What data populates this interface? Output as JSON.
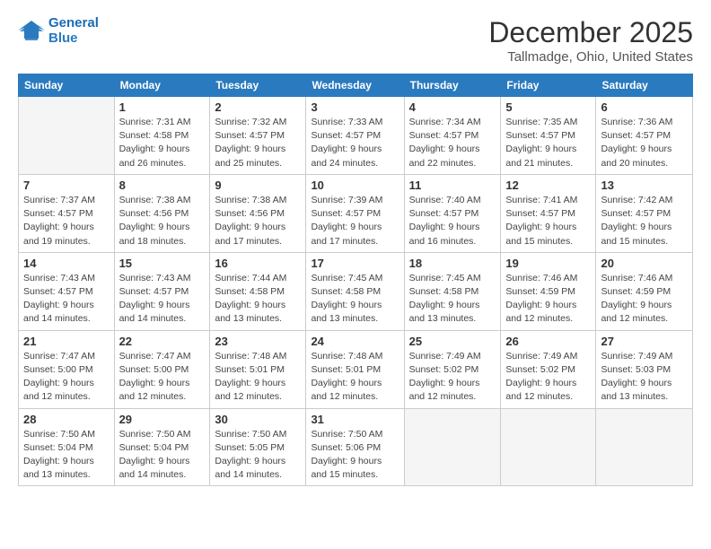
{
  "logo": {
    "line1": "General",
    "line2": "Blue"
  },
  "title": "December 2025",
  "location": "Tallmadge, Ohio, United States",
  "days_of_week": [
    "Sunday",
    "Monday",
    "Tuesday",
    "Wednesday",
    "Thursday",
    "Friday",
    "Saturday"
  ],
  "weeks": [
    [
      {
        "day": "",
        "info": ""
      },
      {
        "day": "1",
        "info": "Sunrise: 7:31 AM\nSunset: 4:58 PM\nDaylight: 9 hours\nand 26 minutes."
      },
      {
        "day": "2",
        "info": "Sunrise: 7:32 AM\nSunset: 4:57 PM\nDaylight: 9 hours\nand 25 minutes."
      },
      {
        "day": "3",
        "info": "Sunrise: 7:33 AM\nSunset: 4:57 PM\nDaylight: 9 hours\nand 24 minutes."
      },
      {
        "day": "4",
        "info": "Sunrise: 7:34 AM\nSunset: 4:57 PM\nDaylight: 9 hours\nand 22 minutes."
      },
      {
        "day": "5",
        "info": "Sunrise: 7:35 AM\nSunset: 4:57 PM\nDaylight: 9 hours\nand 21 minutes."
      },
      {
        "day": "6",
        "info": "Sunrise: 7:36 AM\nSunset: 4:57 PM\nDaylight: 9 hours\nand 20 minutes."
      }
    ],
    [
      {
        "day": "7",
        "info": "Sunrise: 7:37 AM\nSunset: 4:57 PM\nDaylight: 9 hours\nand 19 minutes."
      },
      {
        "day": "8",
        "info": "Sunrise: 7:38 AM\nSunset: 4:56 PM\nDaylight: 9 hours\nand 18 minutes."
      },
      {
        "day": "9",
        "info": "Sunrise: 7:38 AM\nSunset: 4:56 PM\nDaylight: 9 hours\nand 17 minutes."
      },
      {
        "day": "10",
        "info": "Sunrise: 7:39 AM\nSunset: 4:57 PM\nDaylight: 9 hours\nand 17 minutes."
      },
      {
        "day": "11",
        "info": "Sunrise: 7:40 AM\nSunset: 4:57 PM\nDaylight: 9 hours\nand 16 minutes."
      },
      {
        "day": "12",
        "info": "Sunrise: 7:41 AM\nSunset: 4:57 PM\nDaylight: 9 hours\nand 15 minutes."
      },
      {
        "day": "13",
        "info": "Sunrise: 7:42 AM\nSunset: 4:57 PM\nDaylight: 9 hours\nand 15 minutes."
      }
    ],
    [
      {
        "day": "14",
        "info": "Sunrise: 7:43 AM\nSunset: 4:57 PM\nDaylight: 9 hours\nand 14 minutes."
      },
      {
        "day": "15",
        "info": "Sunrise: 7:43 AM\nSunset: 4:57 PM\nDaylight: 9 hours\nand 14 minutes."
      },
      {
        "day": "16",
        "info": "Sunrise: 7:44 AM\nSunset: 4:58 PM\nDaylight: 9 hours\nand 13 minutes."
      },
      {
        "day": "17",
        "info": "Sunrise: 7:45 AM\nSunset: 4:58 PM\nDaylight: 9 hours\nand 13 minutes."
      },
      {
        "day": "18",
        "info": "Sunrise: 7:45 AM\nSunset: 4:58 PM\nDaylight: 9 hours\nand 13 minutes."
      },
      {
        "day": "19",
        "info": "Sunrise: 7:46 AM\nSunset: 4:59 PM\nDaylight: 9 hours\nand 12 minutes."
      },
      {
        "day": "20",
        "info": "Sunrise: 7:46 AM\nSunset: 4:59 PM\nDaylight: 9 hours\nand 12 minutes."
      }
    ],
    [
      {
        "day": "21",
        "info": "Sunrise: 7:47 AM\nSunset: 5:00 PM\nDaylight: 9 hours\nand 12 minutes."
      },
      {
        "day": "22",
        "info": "Sunrise: 7:47 AM\nSunset: 5:00 PM\nDaylight: 9 hours\nand 12 minutes."
      },
      {
        "day": "23",
        "info": "Sunrise: 7:48 AM\nSunset: 5:01 PM\nDaylight: 9 hours\nand 12 minutes."
      },
      {
        "day": "24",
        "info": "Sunrise: 7:48 AM\nSunset: 5:01 PM\nDaylight: 9 hours\nand 12 minutes."
      },
      {
        "day": "25",
        "info": "Sunrise: 7:49 AM\nSunset: 5:02 PM\nDaylight: 9 hours\nand 12 minutes."
      },
      {
        "day": "26",
        "info": "Sunrise: 7:49 AM\nSunset: 5:02 PM\nDaylight: 9 hours\nand 12 minutes."
      },
      {
        "day": "27",
        "info": "Sunrise: 7:49 AM\nSunset: 5:03 PM\nDaylight: 9 hours\nand 13 minutes."
      }
    ],
    [
      {
        "day": "28",
        "info": "Sunrise: 7:50 AM\nSunset: 5:04 PM\nDaylight: 9 hours\nand 13 minutes."
      },
      {
        "day": "29",
        "info": "Sunrise: 7:50 AM\nSunset: 5:04 PM\nDaylight: 9 hours\nand 14 minutes."
      },
      {
        "day": "30",
        "info": "Sunrise: 7:50 AM\nSunset: 5:05 PM\nDaylight: 9 hours\nand 14 minutes."
      },
      {
        "day": "31",
        "info": "Sunrise: 7:50 AM\nSunset: 5:06 PM\nDaylight: 9 hours\nand 15 minutes."
      },
      {
        "day": "",
        "info": ""
      },
      {
        "day": "",
        "info": ""
      },
      {
        "day": "",
        "info": ""
      }
    ]
  ]
}
